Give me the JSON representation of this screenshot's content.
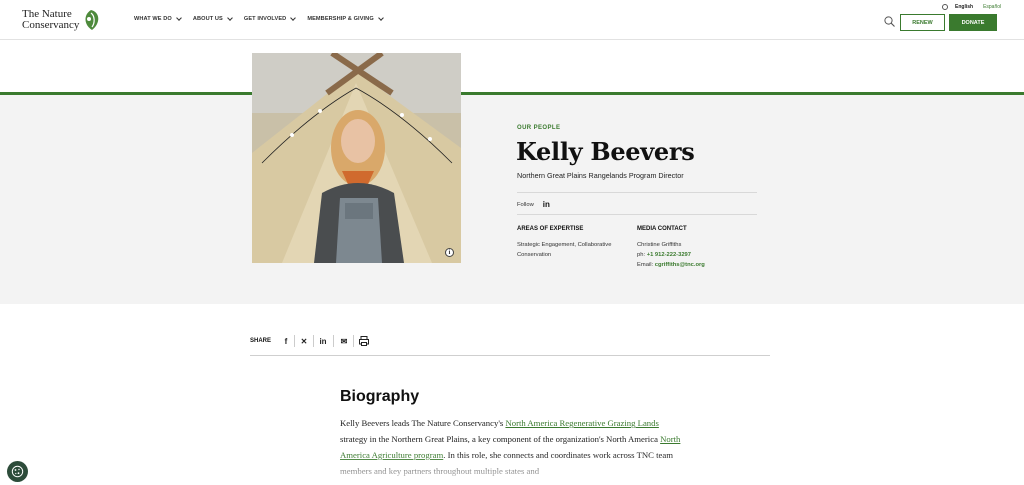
{
  "header": {
    "logo_line1": "The Nature",
    "logo_line2": "Conservancy",
    "nav": [
      "WHAT WE DO",
      "ABOUT US",
      "GET INVOLVED",
      "MEMBERSHIP & GIVING"
    ],
    "lang_en": "English",
    "lang_es": "Español",
    "renew": "RENEW",
    "donate": "DONATE"
  },
  "profile": {
    "eyebrow": "OUR PEOPLE",
    "name": "Kelly Beevers",
    "role": "Northern Great Plains Rangelands Program Director",
    "follow": "Follow",
    "expertise_title": "AREAS OF EXPERTISE",
    "expertise_line1": "Strategic Engagement, Collaborative",
    "expertise_line2": "Conservation",
    "media_title": "MEDIA CONTACT",
    "media_name": "Christine Griffiths",
    "phone_label": "ph:",
    "phone": "+1 912-222-3297",
    "email_label": "Email:",
    "email": "cgriffiths@tnc.org",
    "photo_info": "i"
  },
  "share": {
    "label": "SHARE"
  },
  "bio": {
    "title": "Biography",
    "p1_a": "Kelly Beevers leads The Nature Conservancy's ",
    "link1": "North America Regenerative Grazing Lands",
    "p1_b": " strategy in the Northern Great Plains, a key component of the organization's North America ",
    "link2": "North America Agriculture program",
    "p1_c": ". In this role, she connects and coordinates work across TNC team members and key partners throughout multiple states and"
  },
  "colors": {
    "brand_green": "#3a7a2e",
    "band_gray": "#f3f3f3",
    "cookie_button": "#2d4c3a"
  }
}
